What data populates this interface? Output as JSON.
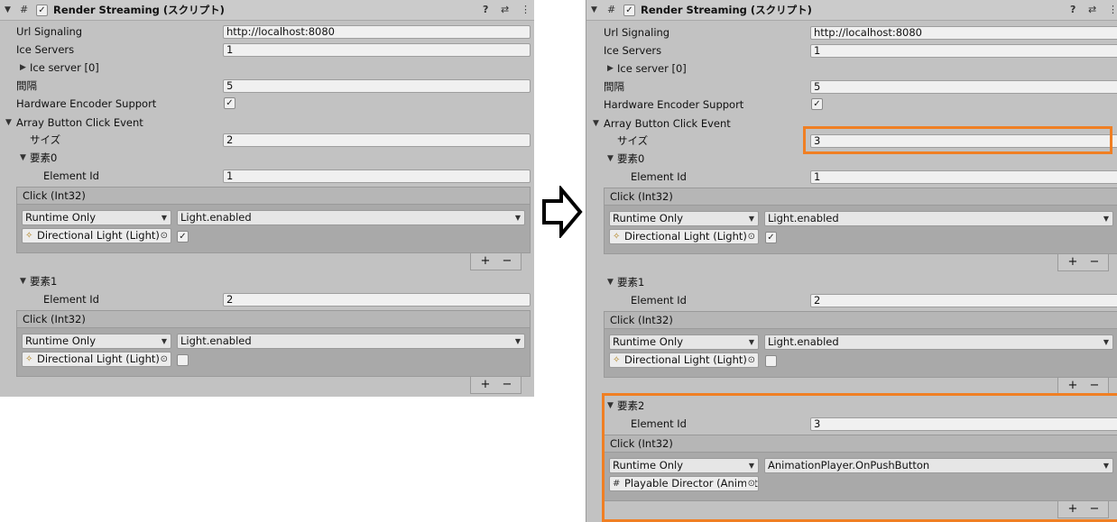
{
  "component": {
    "title": "Render Streaming (スクリプト)",
    "enabled": true,
    "script_icon": "#",
    "help_icon": "?",
    "preset_icon": "⇄",
    "menu_icon": "⋮"
  },
  "fields": {
    "url_signaling_label": "Url Signaling",
    "url_signaling_value": "http://localhost:8080",
    "ice_servers_label": "Ice Servers",
    "ice_servers_value": "1",
    "ice_server0_label": "Ice server [0]",
    "interval_label": "間隔",
    "interval_value": "5",
    "hw_encoder_label": "Hardware Encoder Support",
    "hw_encoder_checked": true,
    "array_label": "Array Button Click Event",
    "size_label": "サイズ",
    "element_id_label": "Element Id",
    "event_header": "Click (Int32)",
    "runtime_only": "Runtime Only",
    "plus": "+",
    "minus": "−"
  },
  "before": {
    "size_value": "2",
    "elements": [
      {
        "label": "要素0",
        "element_id": "1",
        "method": "Light.enabled",
        "target": "Directional Light (Light)",
        "arg_checked": true
      },
      {
        "label": "要素1",
        "element_id": "2",
        "method": "Light.enabled",
        "target": "Directional Light (Light)",
        "arg_checked": false
      }
    ]
  },
  "after": {
    "size_value": "3",
    "elements": [
      {
        "label": "要素0",
        "element_id": "1",
        "method": "Light.enabled",
        "target": "Directional Light (Light)",
        "arg_checked": true
      },
      {
        "label": "要素1",
        "element_id": "2",
        "method": "Light.enabled",
        "target": "Directional Light (Light)",
        "arg_checked": false
      },
      {
        "label": "要素2",
        "element_id": "3",
        "method": "AnimationPlayer.OnPushButton",
        "target": "Playable Director (Animat"
      }
    ]
  },
  "colors": {
    "panel_bg": "#c2c2c2",
    "highlight": "#f07f23",
    "arrow": "#000000"
  }
}
